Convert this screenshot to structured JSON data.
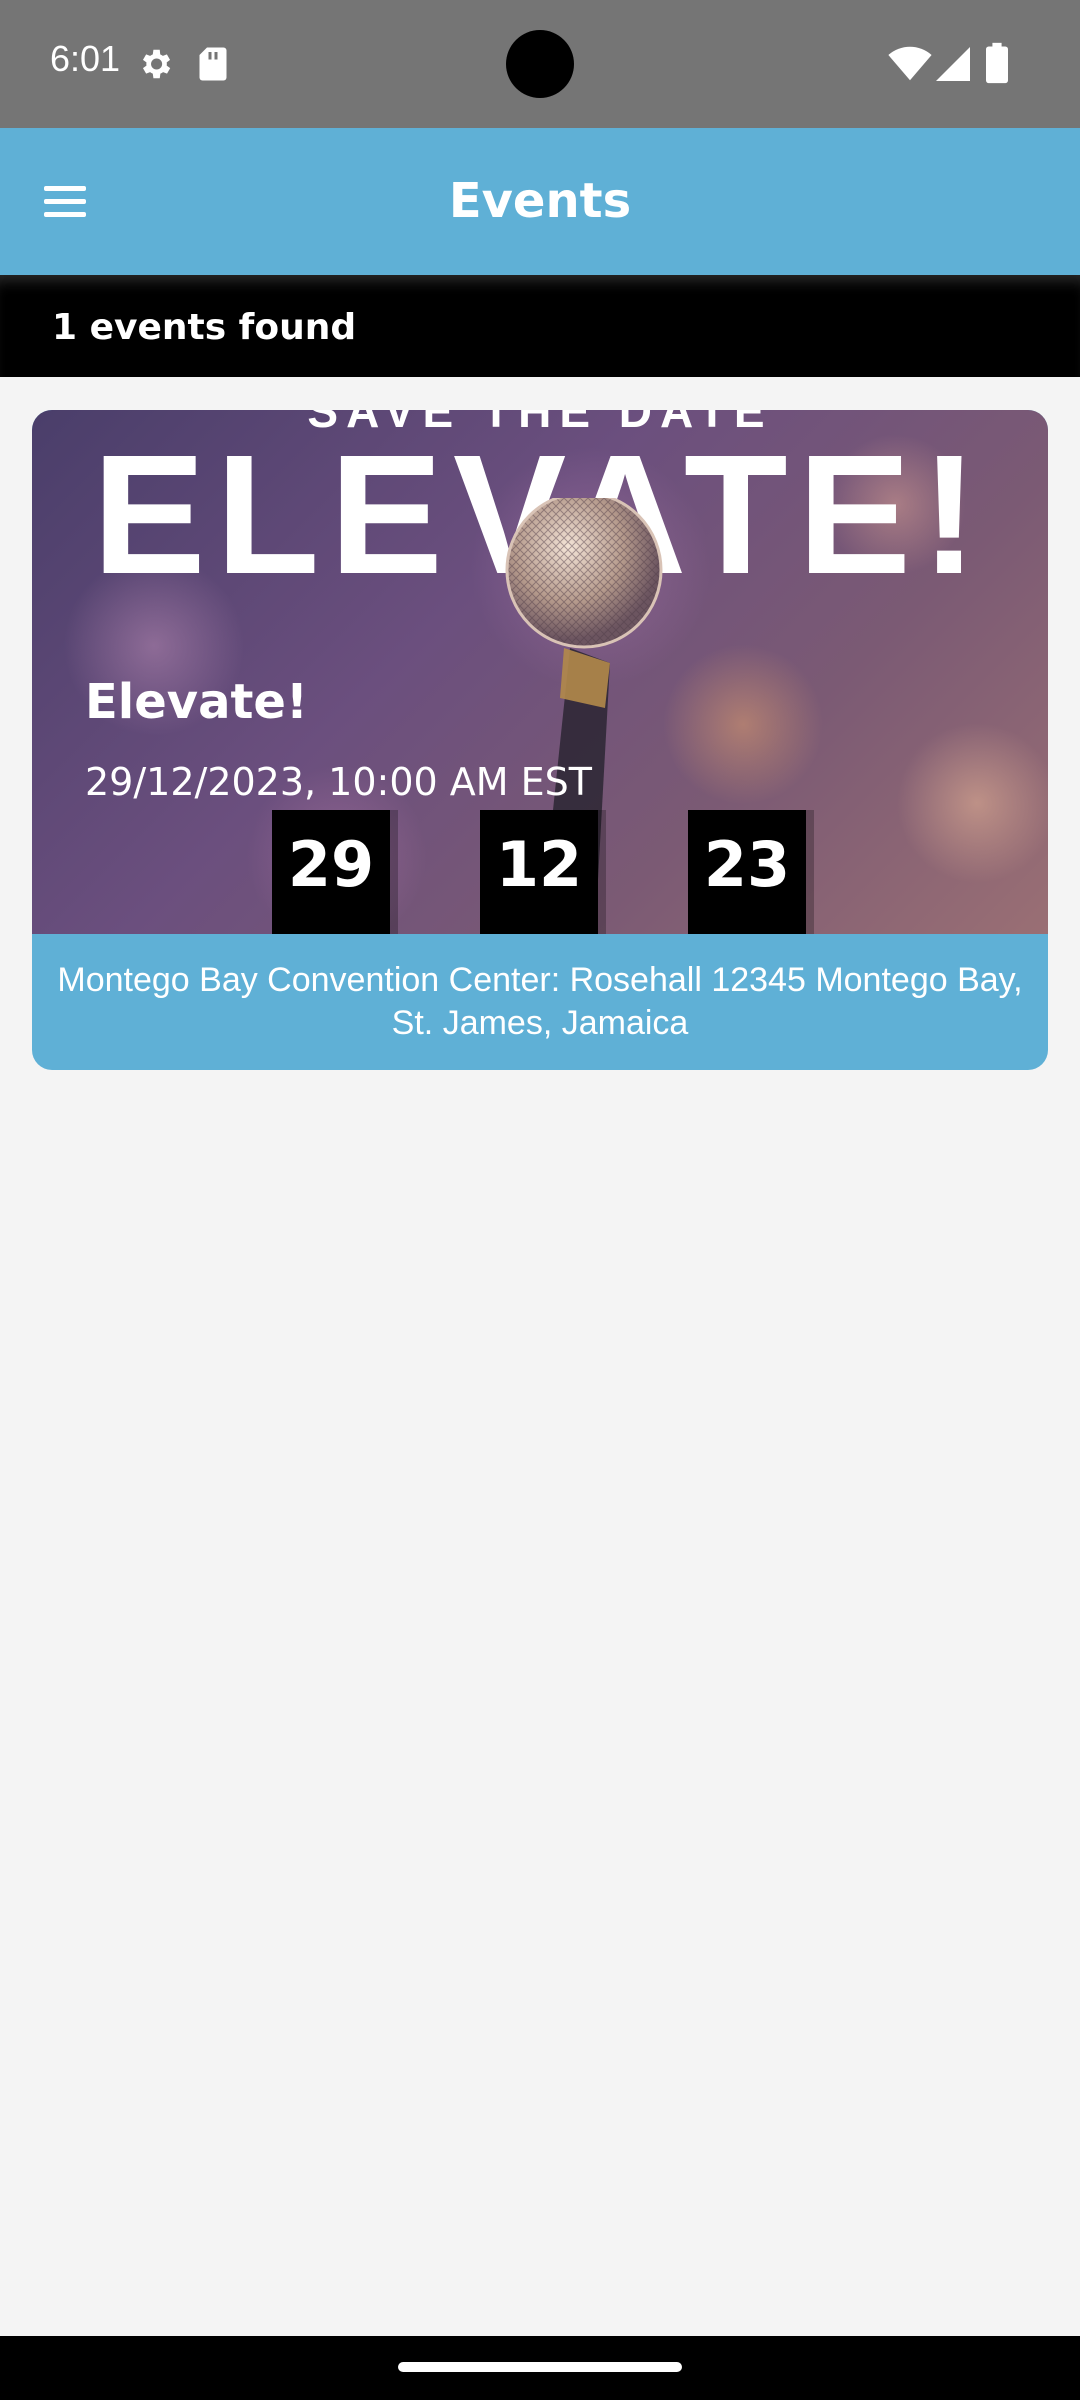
{
  "status_bar": {
    "time": "6:01",
    "icons": [
      "settings-gear-icon",
      "sd-card-icon",
      "wifi-icon",
      "cell-signal-icon",
      "battery-icon"
    ]
  },
  "app_bar": {
    "title": "Events",
    "menu_icon": "hamburger-menu-icon",
    "background_color": "#5fb0d6"
  },
  "results": {
    "count_label": "1 events found"
  },
  "events": [
    {
      "poster_text_top": "SAVE THE DATE",
      "poster_headline": "ELEVATE!",
      "name": "Elevate!",
      "datetime": "29/12/2023, 10:00 AM EST",
      "countdown": [
        "29",
        "12",
        "23"
      ],
      "location": "Montego Bay Convention Center: Rosehall 12345 Montego Bay, St. James, Jamaica"
    }
  ],
  "colors": {
    "accent": "#5fb0d6",
    "page_background": "#f4f4f4",
    "results_bar": "#000000"
  }
}
